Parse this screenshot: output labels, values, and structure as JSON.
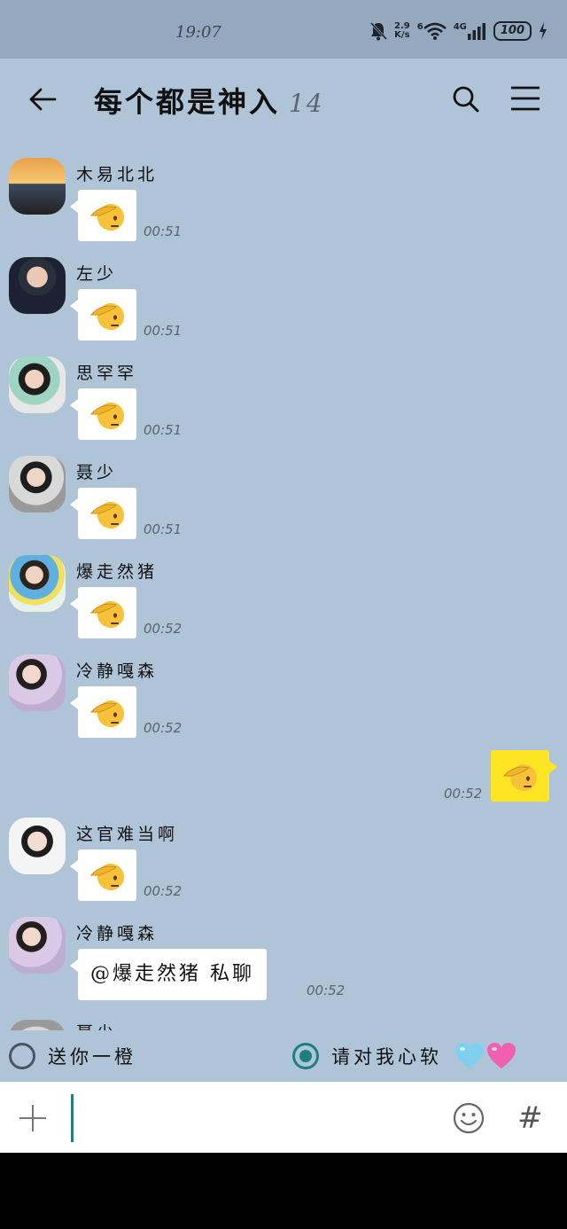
{
  "status_bar": {
    "time": "19:07",
    "net_speed_value": "2.9",
    "net_speed_unit": "K/s",
    "wifi_badge": "6",
    "cell_type": "4G",
    "battery": "100",
    "icons": [
      "bell-off-icon",
      "wifi-icon",
      "signal-icon",
      "battery-icon",
      "charging-icon"
    ]
  },
  "header": {
    "title": "每个都是神入",
    "member_count": "14",
    "icons": [
      "back-arrow-icon",
      "search-icon",
      "menu-icon"
    ]
  },
  "messages": [
    {
      "sender": "木易北北",
      "time": "00:51",
      "type": "sticker",
      "sticker": "saluting-face-emoji"
    },
    {
      "sender": "左少",
      "time": "00:51",
      "type": "sticker",
      "sticker": "saluting-face-emoji"
    },
    {
      "sender": "思罕罕",
      "time": "00:51",
      "type": "sticker",
      "sticker": "saluting-face-emoji"
    },
    {
      "sender": "聂少",
      "time": "00:51",
      "type": "sticker",
      "sticker": "saluting-face-emoji"
    },
    {
      "sender": "爆走然猪",
      "time": "00:52",
      "type": "sticker",
      "sticker": "saluting-face-emoji"
    },
    {
      "sender": "冷静嘎森",
      "time": "00:52",
      "type": "sticker",
      "sticker": "saluting-face-emoji"
    },
    {
      "sender": "",
      "time": "00:52",
      "type": "sticker",
      "sticker": "saluting-face-emoji",
      "mine": true
    },
    {
      "sender": "这官难当啊",
      "time": "00:52",
      "type": "sticker",
      "sticker": "saluting-face-emoji"
    },
    {
      "sender": "冷静嘎森",
      "time": "00:52",
      "type": "text",
      "text": "@爆走然猪 私聊"
    },
    {
      "sender": "聂少",
      "type": "partial"
    }
  ],
  "poll": {
    "option_1": "送你一橙",
    "option_2": "请对我心软",
    "option_2_emoji": [
      "light-blue-heart-emoji",
      "pink-heart-emoji"
    ],
    "selected": 2
  },
  "input_bar": {
    "value": "",
    "icons": [
      "plus-icon",
      "smile-icon",
      "hash-icon"
    ]
  },
  "colors": {
    "chat_background": "#b0c4d8",
    "my_bubble": "#fde524",
    "accent": "#1f7f7a"
  }
}
